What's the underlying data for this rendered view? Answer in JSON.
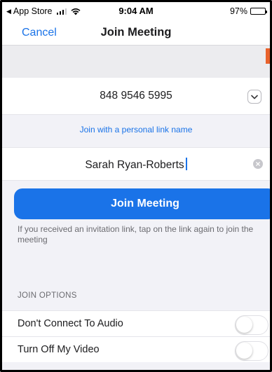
{
  "status_bar": {
    "back_app": "App Store",
    "time": "9:04 AM",
    "battery": "97%"
  },
  "nav": {
    "cancel_label": "Cancel",
    "title": "Join Meeting"
  },
  "meeting": {
    "meeting_id": "848 9546 5995",
    "personal_link_label": "Join with a personal link name",
    "display_name": "Sarah Ryan-Roberts"
  },
  "join_button_label": "Join Meeting",
  "hint_text": "If you received an invitation link, tap on the link again to join the meeting",
  "join_options": {
    "header": "JOIN OPTIONS",
    "items": [
      {
        "label": "Don't Connect To Audio",
        "enabled": false
      },
      {
        "label": "Turn Off My Video",
        "enabled": false
      }
    ]
  },
  "colors": {
    "accent": "#1a73e8",
    "orange_marker": "#e8622c"
  },
  "icons": {
    "back": "back-caret-icon",
    "signal": "cellular-signal-icon",
    "wifi": "wifi-icon",
    "battery": "battery-icon",
    "dropdown": "chevron-down-icon",
    "clear": "clear-icon"
  }
}
